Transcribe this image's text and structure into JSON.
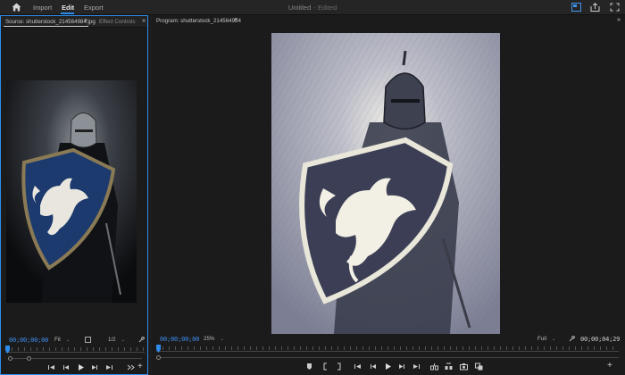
{
  "header": {
    "home_icon": "home-icon",
    "menu": [
      "Import",
      "Edit",
      "Export"
    ],
    "active_menu": "Edit",
    "title": "Untitled",
    "status": "- Edited",
    "right_icons": [
      "quick-export-icon",
      "share-icon",
      "fullscreen-icon"
    ]
  },
  "source": {
    "tab_label": "Source: shutterstock_214564984.jpg",
    "tab2_label": "Effect Controls",
    "timecode": "00;00;00;00",
    "fit": "Fit",
    "resolution": "1/2"
  },
  "program": {
    "tab_label": "Program: shutterstock_214564984",
    "timecode": "00;00;00;00",
    "zoom": "25%",
    "quality": "Full",
    "duration": "00;00;04;29"
  },
  "menu_glyph": "≡",
  "expand_glyph": "»",
  "plus_glyph": "+",
  "caret_glyph": "⌄",
  "colors": {
    "accent": "#2d8ceb",
    "panel_bg": "#1b1b1b",
    "background": "#1d1d1d"
  }
}
